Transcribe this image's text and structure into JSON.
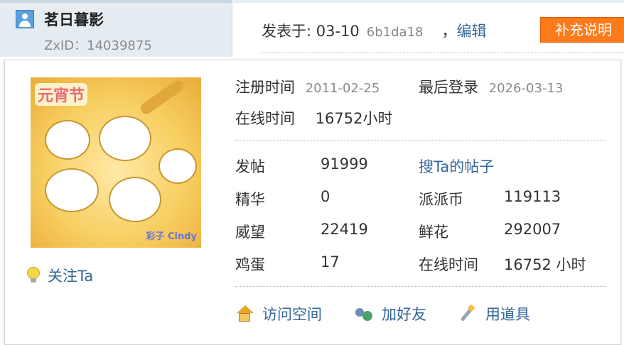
{
  "user": {
    "name": "茗日暮影",
    "zxid": "ZxID：14039875"
  },
  "post_meta": {
    "posted_prefix": "发表于: 03-10",
    "hash": "6b1da18",
    "edit_sep": "，",
    "edit_label": "编辑",
    "supplement_button": "补充说明"
  },
  "profile": {
    "avatar_caption": "元宵节",
    "avatar_signature": "彩子 Cindy",
    "follow_label": "关注Ta",
    "register_label": "注册时间",
    "register_value": "2011-02-25",
    "last_login_label": "最后登录",
    "last_login_value": "2026-03-13",
    "online_label": "在线时间",
    "online_value": "16752小时",
    "stats": {
      "posts_label": "发帖",
      "posts_value": "91999",
      "search_link": "搜Ta的帖子",
      "digest_label": "精华",
      "digest_value": "0",
      "coins_label": "派派币",
      "coins_value": "119113",
      "prestige_label": "威望",
      "prestige_value": "22419",
      "flowers_label": "鲜花",
      "flowers_value": "292007",
      "eggs_label": "鸡蛋",
      "eggs_value": "17",
      "online_label": "在线时间",
      "online_value": "16752 小时"
    },
    "actions": {
      "visit_space": "访问空间",
      "add_friend": "加好友",
      "use_item": "用道具"
    }
  },
  "colors": {
    "link": "#336699",
    "accent_button": "#ff7a1a",
    "header_bg": "#e5edf2"
  }
}
